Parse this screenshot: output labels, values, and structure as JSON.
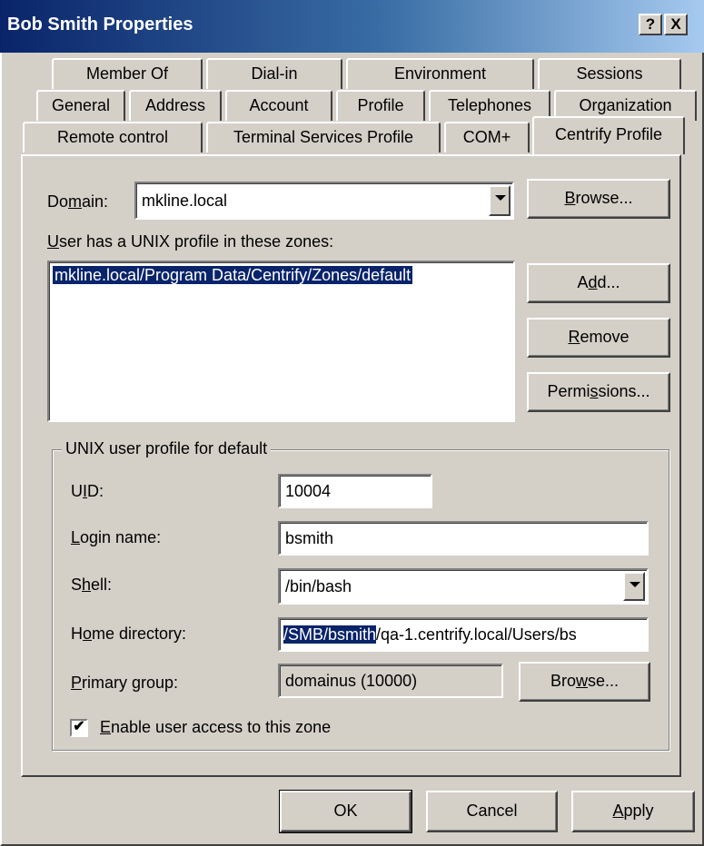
{
  "window": {
    "title": "Bob Smith Properties",
    "help_glyph": "?",
    "close_glyph": "X"
  },
  "tabs": {
    "row1": [
      "Member Of",
      "Dial-in",
      "Environment",
      "Sessions"
    ],
    "row2": [
      "General",
      "Address",
      "Account",
      "Profile",
      "Telephones",
      "Organization"
    ],
    "row3": [
      "Remote control",
      "Terminal Services Profile",
      "COM+",
      "Centrify Profile"
    ],
    "active": "Centrify Profile"
  },
  "domain": {
    "label_a": "Do",
    "label_u": "m",
    "label_b": "ain:",
    "value": "mkline.local",
    "browse_u": "B",
    "browse_rest": "rowse..."
  },
  "zones": {
    "label_u": "U",
    "label_rest": "ser has a UNIX profile in these zones:",
    "items": [
      "mkline.local/Program Data/Centrify/Zones/default"
    ],
    "add_a": "A",
    "add_u": "d",
    "add_b": "d...",
    "remove_u": "R",
    "remove_rest": "emove",
    "perm_a": "Permi",
    "perm_u": "s",
    "perm_b": "sions..."
  },
  "profile": {
    "group_title": "UNIX user profile for default",
    "uid_a": "U",
    "uid_u": "I",
    "uid_b": "D:",
    "uid_value": "10004",
    "login_u": "L",
    "login_rest": "ogin name:",
    "login_value": "bsmith",
    "shell_a": "S",
    "shell_u": "h",
    "shell_b": "ell:",
    "shell_value": "/bin/bash",
    "home_a": "H",
    "home_u": "o",
    "home_b": "me directory:",
    "home_selected": "/SMB/bsmith",
    "home_rest": "/qa-1.centrify.local/Users/bs",
    "pg_u": "P",
    "pg_rest": "rimary group:",
    "pg_value": "domainus (10000)",
    "pg_browse_a": "Bro",
    "pg_browse_u": "w",
    "pg_browse_b": "se...",
    "enable_checked": "✔",
    "enable_u": "E",
    "enable_rest": "nable user access to this zone"
  },
  "footer": {
    "ok": "OK",
    "cancel": "Cancel",
    "apply_u": "A",
    "apply_rest": "pply"
  }
}
